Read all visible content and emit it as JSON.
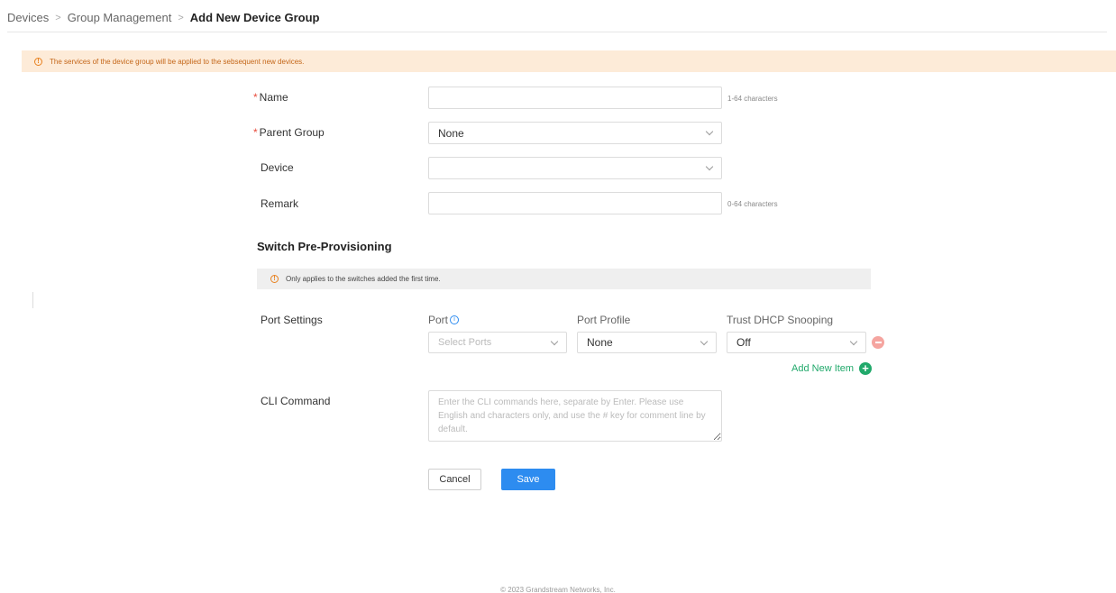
{
  "breadcrumb": {
    "items": [
      "Devices",
      "Group Management"
    ],
    "current": "Add New Device Group"
  },
  "notice": {
    "text": "The services of the device group will be applied to the sebsequent new devices.",
    "icon": "warning-circle-icon",
    "color": "#fdebd8"
  },
  "form": {
    "name": {
      "label": "Name",
      "required": true,
      "value": "",
      "hint": "1-64 characters"
    },
    "parent_group": {
      "label": "Parent Group",
      "required": true,
      "value": "None"
    },
    "device": {
      "label": "Device",
      "value": ""
    },
    "remark": {
      "label": "Remark",
      "value": "",
      "hint": "0-64 characters"
    }
  },
  "switch": {
    "title": "Switch Pre-Provisioning",
    "notice": "Only applies to the switches added the first time.",
    "port_settings": {
      "label": "Port Settings",
      "columns": {
        "port": "Port",
        "port_profile": "Port Profile",
        "trust_dhcp": "Trust DHCP Snooping"
      },
      "row": {
        "port_placeholder": "Select Ports",
        "port_profile": "None",
        "trust_dhcp": "Off"
      },
      "add_label": "Add New Item"
    },
    "cli": {
      "label": "CLI Command",
      "placeholder": "Enter the CLI commands here, separate by Enter. Please use English and characters only, and use the # key for comment line by default."
    }
  },
  "buttons": {
    "cancel": "Cancel",
    "save": "Save"
  },
  "footer": "© 2023 Grandstream Networks, Inc.",
  "colors": {
    "primary": "#2d8cf0",
    "add": "#21a96b",
    "remove": "#f5a5a0",
    "required": "#e84c3d"
  }
}
